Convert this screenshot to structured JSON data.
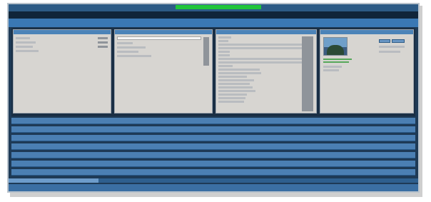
{
  "colors": {
    "frame": "#1e3a56",
    "topbar": "#2d5b86",
    "accent_green": "#21c53a",
    "header": "#3a78b4",
    "row_bar": "#4b7fb3",
    "panel_bg": "#d7d5d1"
  },
  "topbar": {
    "tabs": [
      "",
      "",
      "",
      "",
      "",
      ""
    ]
  },
  "header": {
    "title": ""
  },
  "panels": [
    {
      "title": ""
    },
    {
      "title": ""
    },
    {
      "title": ""
    },
    {
      "title": ""
    }
  ],
  "rows": [
    "",
    "",
    "",
    "",
    "",
    "",
    ""
  ],
  "progress": {
    "value": 0.22
  },
  "footer": {
    "items": [
      "",
      "",
      ""
    ]
  }
}
